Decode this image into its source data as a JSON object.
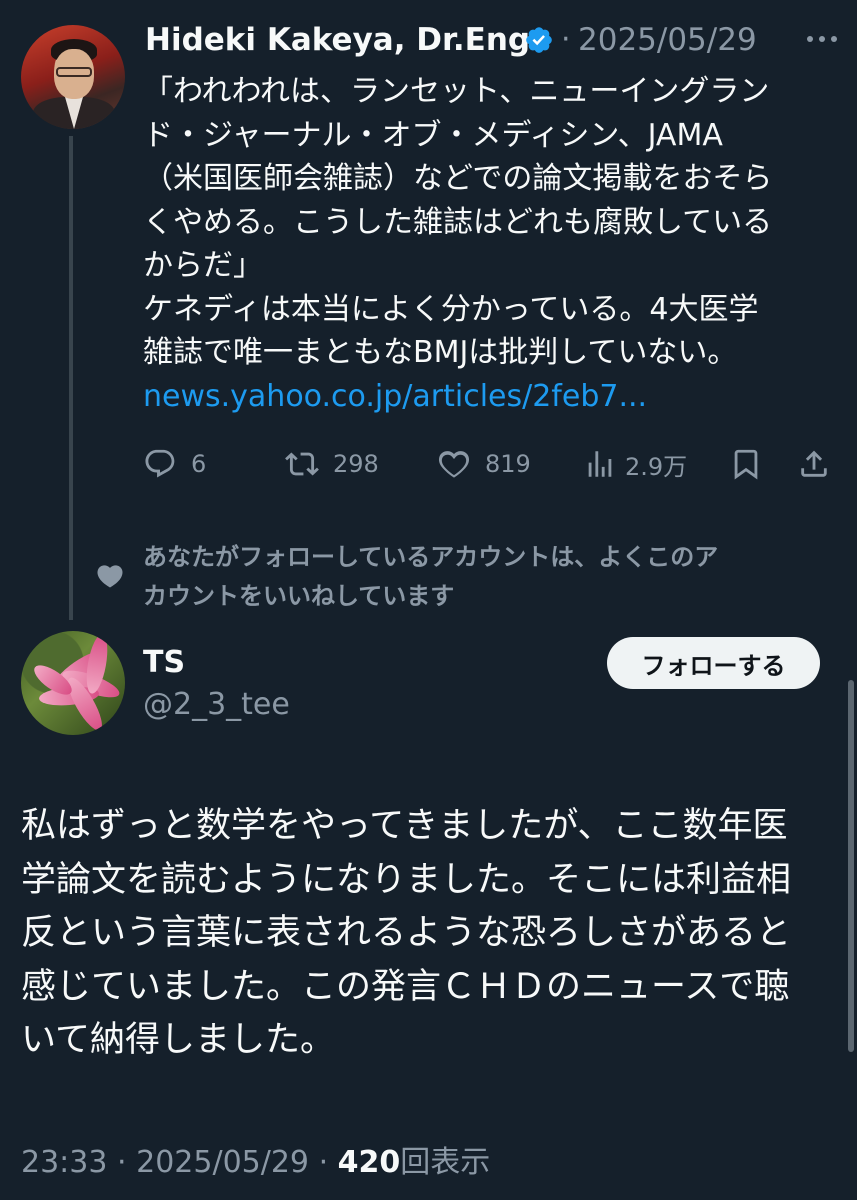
{
  "quoted_tweet": {
    "author_name": "Hideki Kakeya, Dr.Eng.",
    "separator": "·",
    "date": "2025/05/29",
    "text_lines": [
      "「われわれは、ランセット、ニューイングラン",
      "ド・ジャーナル・オブ・メディシン、JAMA",
      "（米国医師会雑誌）などでの論文掲載をおそら",
      "くやめる。こうした雑誌はどれも腐敗している",
      "からだ」",
      "ケネディは本当によく分かっている。4大医学",
      "雑誌で唯一まともなBMJは批判していない。"
    ],
    "link": "news.yahoo.co.jp/articles/2feb7...",
    "actions": {
      "replies": "6",
      "reposts": "298",
      "likes": "819",
      "views": "2.9万"
    }
  },
  "social_context": {
    "line1": "あなたがフォローしているアカウントは、よくこのア",
    "line2": "カウントをいいねしています"
  },
  "main_tweet": {
    "author_name": "TS",
    "handle": "@2_3_tee",
    "follow_label": "フォローする",
    "text_lines": [
      "私はずっと数学をやってきましたが、ここ数年医",
      "学論文を読むようになりました。そこには利益相",
      "反という言葉に表されるような恐ろしさがあると",
      "感じていました。この発言ＣＨＤのニュースで聴",
      "いて納得しました。"
    ],
    "time": "23:33",
    "sep1": "·",
    "date": "2025/05/29",
    "sep2": "·",
    "view_count": "420",
    "view_label": "回表示"
  },
  "colors": {
    "background": "#15202b",
    "text": "#f7f9f9",
    "secondary": "#8b98a5",
    "link": "#1d9bf0",
    "verified": "#1d9bf0"
  },
  "icons": [
    "more-icon",
    "verified-badge-icon",
    "reply-icon",
    "repost-icon",
    "like-icon",
    "analytics-icon",
    "bookmark-icon",
    "share-icon",
    "heart-icon"
  ]
}
